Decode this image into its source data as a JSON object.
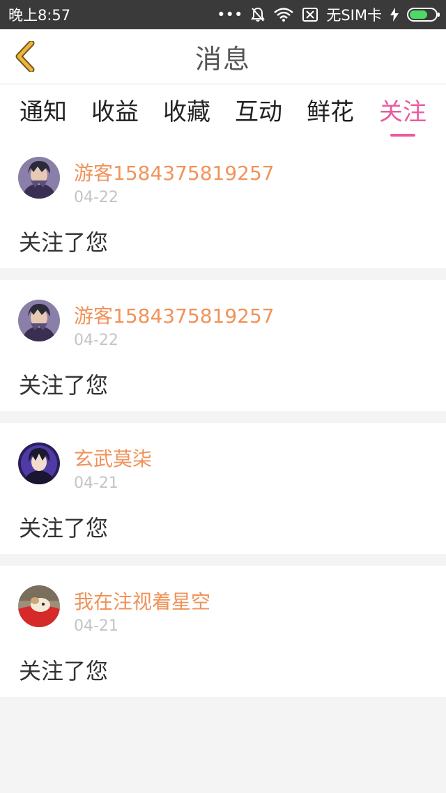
{
  "status": {
    "time": "晚上8:57",
    "dots": "•••",
    "sim": "无SIM卡"
  },
  "header": {
    "title": "消息"
  },
  "tabs": [
    {
      "label": "通知",
      "active": false
    },
    {
      "label": "收益",
      "active": false
    },
    {
      "label": "收藏",
      "active": false
    },
    {
      "label": "互动",
      "active": false
    },
    {
      "label": "鲜花",
      "active": false
    },
    {
      "label": "关注",
      "active": true
    }
  ],
  "colors": {
    "accent": "#e95ba0",
    "username": "#f0925a",
    "date": "#c4c4c4",
    "back_arrow": "#f2b33d"
  },
  "feed": [
    {
      "user": "游客1584375819257",
      "date": "04-22",
      "text": "关注了您",
      "avatar": "avatar-anime-1"
    },
    {
      "user": "游客1584375819257",
      "date": "04-22",
      "text": "关注了您",
      "avatar": "avatar-anime-1"
    },
    {
      "user": "玄武莫柒",
      "date": "04-21",
      "text": "关注了您",
      "avatar": "avatar-anime-2"
    },
    {
      "user": "我在注视着星空",
      "date": "04-21",
      "text": "关注了您",
      "avatar": "avatar-dog"
    }
  ]
}
